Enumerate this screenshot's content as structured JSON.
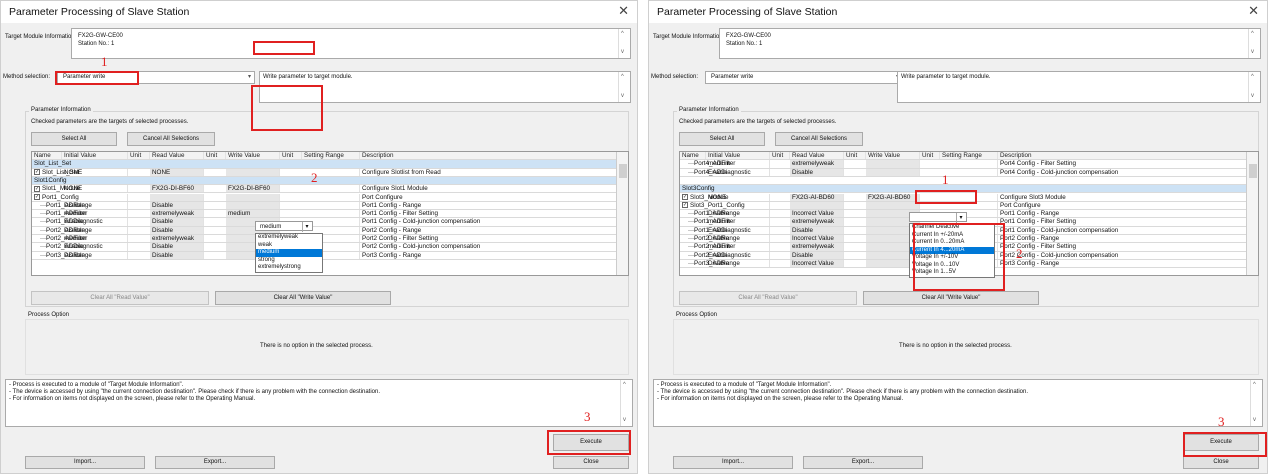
{
  "title": "Parameter Processing of Slave Station",
  "target_label": "Target Module Information:",
  "target_lines": [
    "FX2G-GW-CE00",
    "Station No.: 1"
  ],
  "method_label": "Method selection:",
  "method_value": "Parameter write",
  "method_desc": "Write parameter to target module.",
  "param_group": "Parameter Information",
  "param_note": "Checked parameters are the targets of selected processes.",
  "select_all": "Select All",
  "cancel_all": "Cancel All Selections",
  "columns": [
    "Name",
    "Initial Value",
    "Unit",
    "Read Value",
    "Unit",
    "Write Value",
    "Unit",
    "Setting Range",
    "Description"
  ],
  "clear_read": "Clear All \"Read Value\"",
  "clear_write": "Clear All \"Write Value\"",
  "process_option": "Process Option",
  "no_option": "There is no option in the selected process.",
  "notes": [
    "- Process is executed to a module of \"Target Module Information\".",
    "- The device is accessed by using \"the current connection destination\". Please check if there is any problem with the connection destination.",
    "- For information on items not displayed on the screen, please refer to the Operating Manual."
  ],
  "execute": "Execute",
  "import": "Import...",
  "export": "Export...",
  "close": "Close",
  "close_glyph": "✕",
  "left": {
    "rows": [
      {
        "type": "sec",
        "name": "Slot_List_Set"
      },
      {
        "type": "item",
        "chk": true,
        "name": "Slot_List_Set",
        "init": "NONE",
        "read": "NONE",
        "write": "",
        "desc": "Configure Slotlist from Read"
      },
      {
        "type": "sec",
        "name": "Slot1Config"
      },
      {
        "type": "item",
        "chk": true,
        "name": "Slot1_Module",
        "init": "NONE",
        "read": "FX2G-DI-BF60",
        "write": "FX2G-DI-BF60",
        "desc": "Configure Slot1 Module"
      },
      {
        "type": "item",
        "chk": true,
        "name": "Port1_Config",
        "init": "",
        "read": "",
        "write": "",
        "desc": "Port Configure"
      },
      {
        "type": "child",
        "name": "Port1_ADRange",
        "init": "Disable",
        "read": "Disable",
        "write": "",
        "desc": "Port1 Config - Range"
      },
      {
        "type": "child",
        "name": "Port1_ADFilter",
        "init": "medium",
        "read": "extremelyweak",
        "write": "medium",
        "desc": "Port1 Config - Filter Setting"
      },
      {
        "type": "child",
        "name": "Port1_ADDiagnostic",
        "init": "Enable",
        "read": "Disable",
        "write": "",
        "desc": "Port1 Config - Cold-junction compensation"
      },
      {
        "type": "child",
        "name": "Port2_ADRange",
        "init": "Disable",
        "read": "Disable",
        "write": "",
        "desc": "Port2 Config - Range"
      },
      {
        "type": "child",
        "name": "Port2_ADFilter",
        "init": "medium",
        "read": "extremelyweak",
        "write": "",
        "desc": "Port2 Config - Filter Setting"
      },
      {
        "type": "child",
        "name": "Port2_ADDiagnostic",
        "init": "Enable",
        "read": "Disable",
        "write": "",
        "desc": "Port2 Config - Cold-junction compensation"
      },
      {
        "type": "child",
        "name": "Port3_ADRange",
        "init": "Disable",
        "read": "Disable",
        "write": "",
        "desc": "Port3 Config - Range"
      }
    ],
    "dropdown": [
      "extremelyweak",
      "weak",
      "medium",
      "strong",
      "extremelystrong"
    ],
    "dropdown_selected": "medium",
    "marks": [
      "1",
      "2",
      "3"
    ]
  },
  "right": {
    "rows": [
      {
        "type": "child",
        "name": "Port4_ADFilter",
        "init": "medium",
        "read": "extremelyweak",
        "write": "",
        "desc": "Port4 Config - Filter Setting"
      },
      {
        "type": "child",
        "name": "Port4_ADDiagnostic",
        "init": "Enable",
        "read": "Disable",
        "write": "",
        "desc": "Port4 Config - Cold-junction compensation"
      },
      {
        "type": "gap",
        "name": ""
      },
      {
        "type": "sec",
        "name": "Slot3Config"
      },
      {
        "type": "item",
        "chk": true,
        "name": "Slot3_Module",
        "init": "NONE",
        "read": "FX2G-AI-BD60",
        "write": "FX2G-AI-BD60",
        "desc": "Configure Slot3 Module"
      },
      {
        "type": "item",
        "chk": true,
        "name": "Slot3_Port1_Config",
        "init": "",
        "read": "",
        "write": "",
        "desc": "Port Configure"
      },
      {
        "type": "child",
        "name": "Port1_ADRange",
        "init": "Disable",
        "read": "Incorrect Value",
        "write": "",
        "desc": "Port1 Config - Range"
      },
      {
        "type": "child",
        "name": "Port1_ADFilter",
        "init": "medium",
        "read": "extremelyweak",
        "write": "",
        "desc": "Port1 Config - Filter Setting"
      },
      {
        "type": "child",
        "name": "Port1_ADDiagnostic",
        "init": "Enable",
        "read": "Disable",
        "write": "",
        "desc": "Port1 Config - Cold-junction compensation"
      },
      {
        "type": "child",
        "name": "Port2_ADRange",
        "init": "Disable",
        "read": "Incorrect Value",
        "write": "",
        "desc": "Port2 Config - Range"
      },
      {
        "type": "child",
        "name": "Port2_ADFilter",
        "init": "medium",
        "read": "extremelyweak",
        "write": "",
        "desc": "Port2 Config - Filter Setting"
      },
      {
        "type": "child",
        "name": "Port2_ADDiagnostic",
        "init": "Enable",
        "read": "Disable",
        "write": "",
        "desc": "Port2 Config - Cold-junction compensation"
      },
      {
        "type": "child",
        "name": "Port3_ADRange",
        "init": "Disable",
        "read": "Incorrect Value",
        "write": "",
        "desc": "Port3 Config - Range"
      }
    ],
    "dropdown": [
      "Channel Deactive",
      "Current In +/-20mA",
      "Current In 0...20mA",
      "Current In 4...20mA",
      "Voltage In +/-10V",
      "Voltage In 0...10V",
      "Voltage In 1...5V"
    ],
    "dropdown_selected": "Current In 4...20mA",
    "marks": [
      "1",
      "2",
      "3"
    ]
  }
}
